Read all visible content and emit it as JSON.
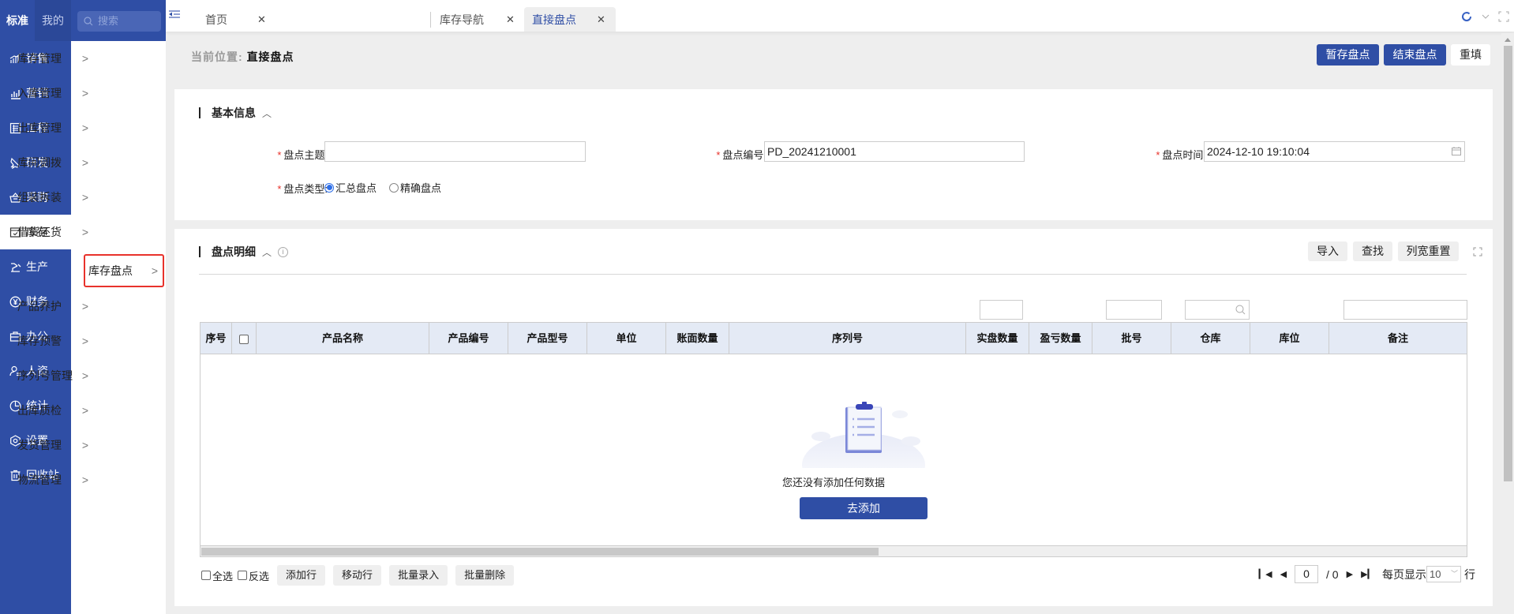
{
  "nav": {
    "tabs": [
      {
        "label": "标准"
      },
      {
        "label": "我的"
      }
    ],
    "search_placeholder": "搜索",
    "items": [
      {
        "label": "销售",
        "icon": "sales-chart-icon"
      },
      {
        "label": "营销",
        "icon": "bar-chart-icon"
      },
      {
        "label": "工程",
        "icon": "document-list-icon"
      },
      {
        "label": "研发",
        "icon": "rocket-icon"
      },
      {
        "label": "采购",
        "icon": "basket-icon"
      },
      {
        "label": "库存",
        "icon": "inventory-box-icon",
        "active": true
      },
      {
        "label": "生产",
        "icon": "robot-arm-icon"
      },
      {
        "label": "财务",
        "icon": "yen-circle-icon"
      },
      {
        "label": "办公",
        "icon": "briefcase-icon"
      },
      {
        "label": "人资",
        "icon": "user-list-icon"
      },
      {
        "label": "统计",
        "icon": "pie-chart-icon"
      },
      {
        "label": "设置",
        "icon": "hexagon-settings-icon"
      },
      {
        "label": "回收站",
        "icon": "trash-icon"
      }
    ]
  },
  "submenu": {
    "items": [
      {
        "label": "库存管理"
      },
      {
        "label": "入库管理"
      },
      {
        "label": "出库管理"
      },
      {
        "label": "库间调拨"
      },
      {
        "label": "组装拆装"
      },
      {
        "label": "借货还货"
      },
      {
        "label": "库存盘点",
        "highlighted": true
      },
      {
        "label": "产品养护"
      },
      {
        "label": "库存预警"
      },
      {
        "label": "序列号管理"
      },
      {
        "label": "出库质检"
      },
      {
        "label": "发货管理"
      },
      {
        "label": "物流管理"
      }
    ]
  },
  "tabs": [
    {
      "label": "首页"
    },
    {
      "label": "库存导航"
    },
    {
      "label": "直接盘点",
      "active": true
    }
  ],
  "breadcrumb": {
    "prefix": "当前位置:",
    "current": "直接盘点"
  },
  "actions": {
    "save_draft": "暂存盘点",
    "finish": "结束盘点",
    "reset": "重填"
  },
  "basic_info": {
    "title": "基本信息",
    "fields": {
      "subject": {
        "label": "盘点主题:",
        "value": ""
      },
      "number": {
        "label": "盘点编号:",
        "value": "PD_20241210001"
      },
      "time": {
        "label": "盘点时间:",
        "value": "2024-12-10 19:10:04"
      },
      "type": {
        "label": "盘点类型:",
        "options": [
          {
            "label": "汇总盘点",
            "checked": true
          },
          {
            "label": "精确盘点",
            "checked": false
          }
        ]
      }
    }
  },
  "detail": {
    "title": "盘点明细",
    "toolbar": {
      "import": "导入",
      "find": "查找",
      "reset_width": "列宽重置"
    },
    "columns": [
      "序号",
      "",
      "产品名称",
      "产品编号",
      "产品型号",
      "单位",
      "账面数量",
      "序列号",
      "实盘数量",
      "盈亏数量",
      "批号",
      "仓库",
      "库位",
      "备注"
    ],
    "empty_text": "您还没有添加任何数据",
    "empty_button": "去添加",
    "bottom": {
      "select_all": "全选",
      "invert": "反选",
      "add_row": "添加行",
      "move_row": "移动行",
      "batch_input": "批量录入",
      "batch_delete": "批量删除"
    },
    "pager": {
      "current": "0",
      "total": "/ 0",
      "per_page_label": "每页显示",
      "per_page": "10",
      "rows_label": "行"
    }
  }
}
